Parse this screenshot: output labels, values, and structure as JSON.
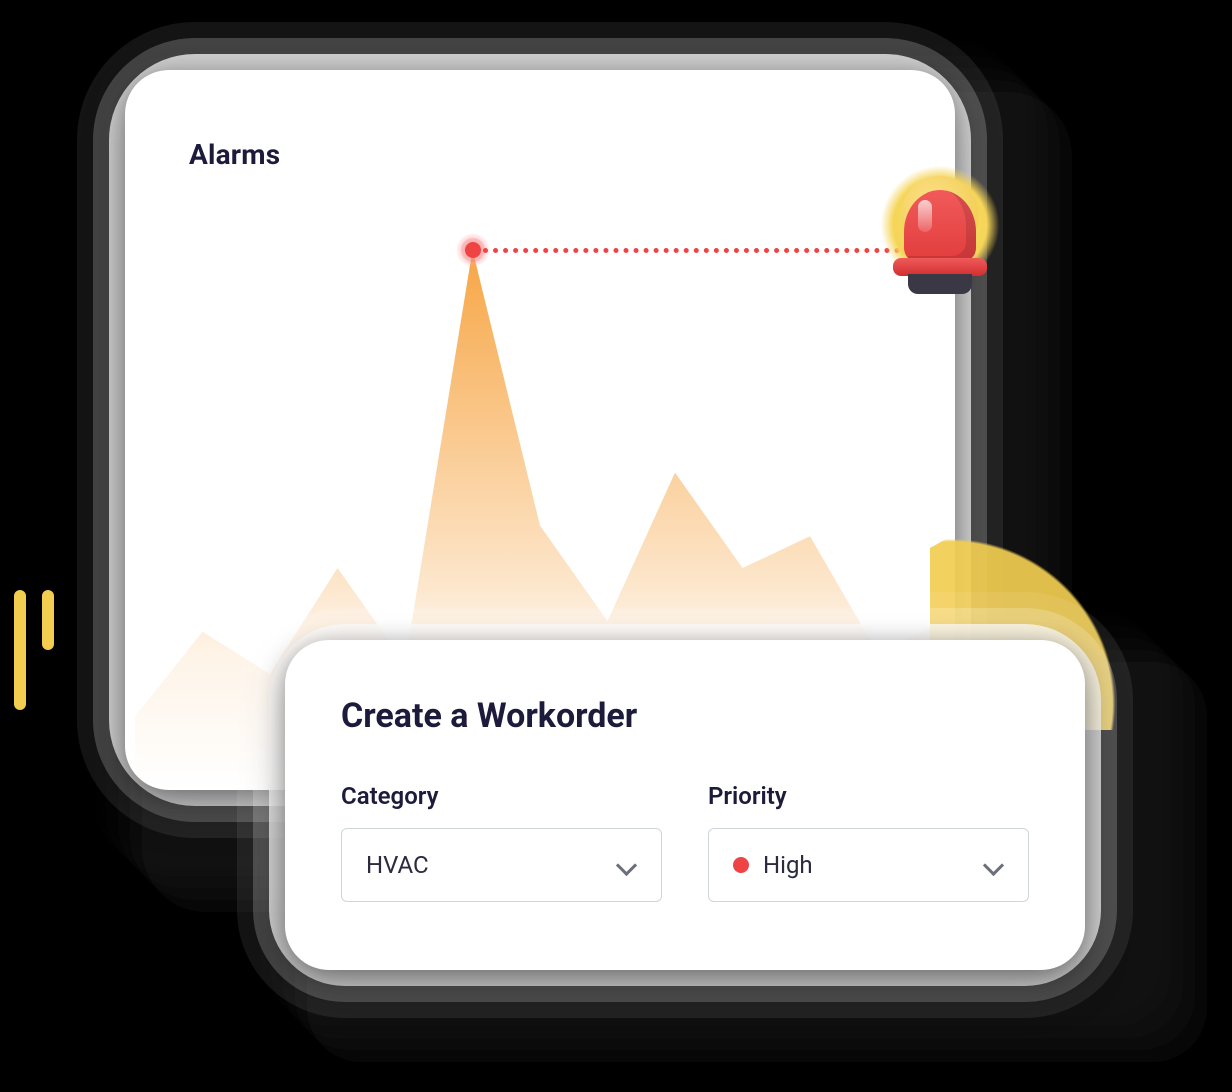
{
  "alarms": {
    "title": "Alarms"
  },
  "workorder": {
    "title": "Create a Workorder",
    "fields": {
      "category": {
        "label": "Category",
        "value": "HVAC"
      },
      "priority": {
        "label": "Priority",
        "value": "High",
        "dot_color": "#ef4444"
      }
    }
  },
  "chart_data": {
    "type": "area",
    "title": "Alarms",
    "xlabel": "",
    "ylabel": "",
    "x": [
      0,
      1,
      2,
      3,
      4,
      5,
      6,
      7,
      8,
      9,
      10,
      11,
      12
    ],
    "values": [
      12,
      28,
      20,
      40,
      22,
      100,
      48,
      30,
      58,
      40,
      46,
      24,
      30
    ],
    "ylim": [
      0,
      100
    ],
    "peak_index": 5,
    "peak_value": 100,
    "series": [
      {
        "name": "Alarms",
        "values": [
          12,
          28,
          20,
          40,
          22,
          100,
          48,
          30,
          58,
          40,
          46,
          24,
          30
        ]
      }
    ],
    "fill_gradient": [
      "#f6a13b",
      "#f6a13b00"
    ],
    "marker_color": "#ef4444"
  },
  "colors": {
    "brand_yellow": "#f2cd50",
    "ink": "#1d1b3b",
    "danger": "#ef4444",
    "border": "#cfd6db"
  }
}
